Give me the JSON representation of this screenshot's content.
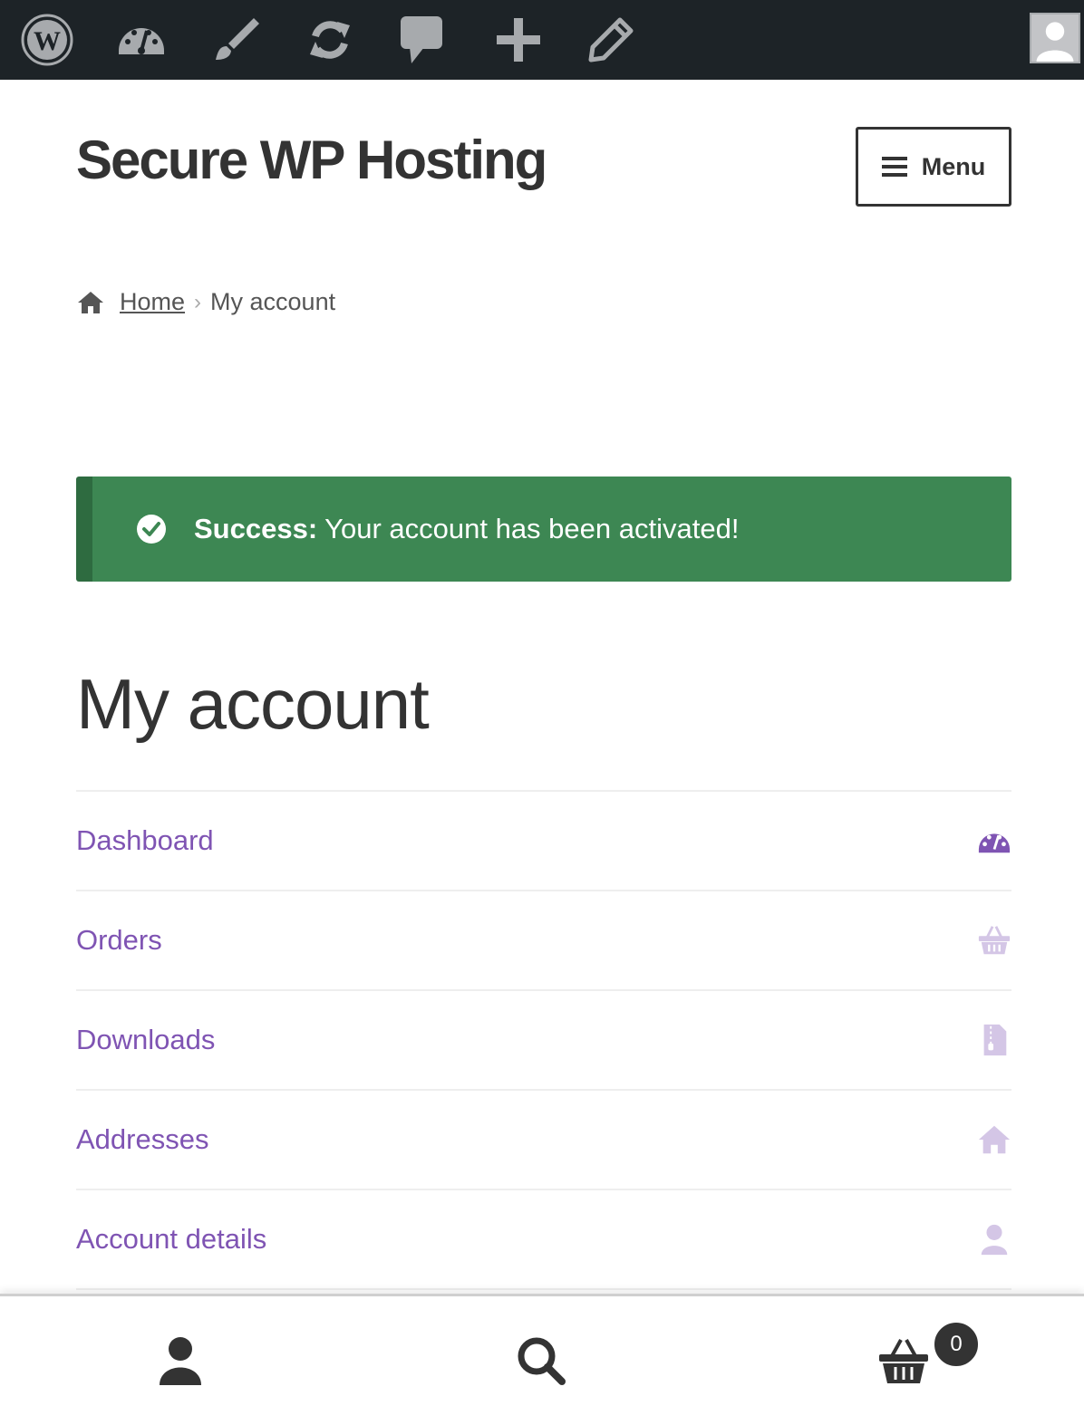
{
  "admin_bar": {
    "items": [
      "wordpress-logo",
      "dashboard-icon",
      "customize-brush-icon",
      "updates-icon",
      "comments-icon",
      "new-content-plus-icon",
      "edit-pencil-icon"
    ],
    "avatar": "user-avatar"
  },
  "header": {
    "site_title": "Secure WP Hosting",
    "menu_label": "Menu"
  },
  "breadcrumb": {
    "home": "Home",
    "current": "My account"
  },
  "notice": {
    "label": "Success:",
    "message": "Your account has been activated!",
    "color": "#3d8753"
  },
  "page_title": "My account",
  "account_nav": [
    {
      "label": "Dashboard",
      "icon": "dashboard-icon"
    },
    {
      "label": "Orders",
      "icon": "basket-icon"
    },
    {
      "label": "Downloads",
      "icon": "file-archive-icon"
    },
    {
      "label": "Addresses",
      "icon": "home-icon"
    },
    {
      "label": "Account details",
      "icon": "user-icon"
    }
  ],
  "footer_bar": {
    "cart_count": "0"
  },
  "colors": {
    "admin_bar": "#1d2327",
    "link_purple": "#7f54b3",
    "icon_light": "#d4c6e6"
  }
}
